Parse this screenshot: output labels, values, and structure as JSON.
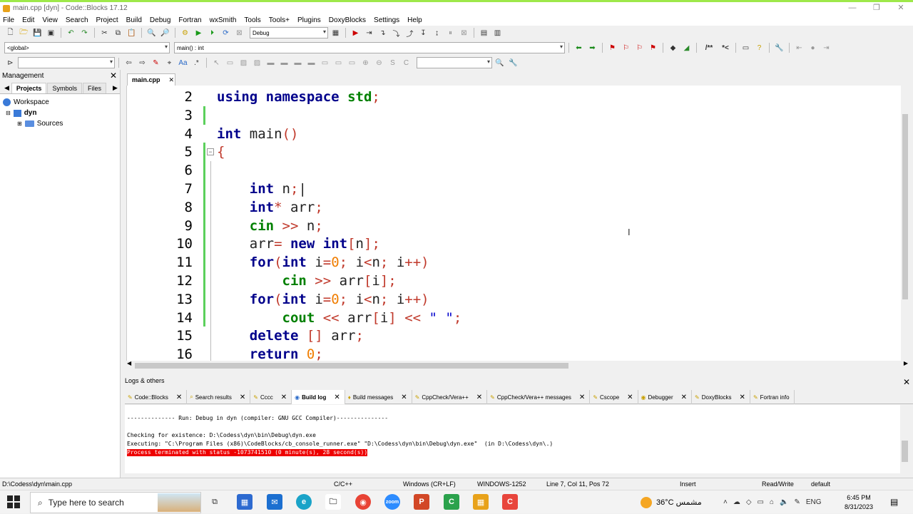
{
  "window": {
    "title": "main.cpp [dyn] - Code::Blocks 17.12",
    "controls": [
      "—",
      "❐",
      "✕"
    ]
  },
  "menu": [
    "File",
    "Edit",
    "View",
    "Search",
    "Project",
    "Build",
    "Debug",
    "Fortran",
    "wxSmith",
    "Tools",
    "Tools+",
    "Plugins",
    "DoxyBlocks",
    "Settings",
    "Help"
  ],
  "toolbar": {
    "build_target": "Debug",
    "scope": "<global>",
    "function": "main() : int"
  },
  "management": {
    "title": "Management",
    "tabs": [
      "Projects",
      "Symbols",
      "Files"
    ],
    "tree": [
      {
        "label": "Workspace",
        "icon": "workspace-icon"
      },
      {
        "label": "dyn",
        "icon": "project-icon"
      },
      {
        "label": "Sources",
        "icon": "folder-icon"
      }
    ]
  },
  "editor": {
    "tab_label": "main.cpp",
    "lines": [
      {
        "no": "2",
        "tokens": [
          [
            "kw",
            "using"
          ],
          [
            "id",
            " "
          ],
          [
            "kw",
            "namespace"
          ],
          [
            "id",
            " "
          ],
          [
            "ns",
            "std"
          ],
          [
            "op",
            ";"
          ]
        ]
      },
      {
        "no": "3",
        "tokens": []
      },
      {
        "no": "4",
        "tokens": [
          [
            "kw",
            "int"
          ],
          [
            "id",
            " main"
          ],
          [
            "op",
            "()"
          ]
        ]
      },
      {
        "no": "5",
        "tokens": [
          [
            "op",
            "{"
          ]
        ]
      },
      {
        "no": "6",
        "tokens": []
      },
      {
        "no": "7",
        "tokens": [
          [
            "id",
            "    "
          ],
          [
            "kw",
            "int"
          ],
          [
            "id",
            " n"
          ],
          [
            "op",
            ";"
          ],
          [
            "id",
            "|"
          ]
        ]
      },
      {
        "no": "8",
        "tokens": [
          [
            "id",
            "    "
          ],
          [
            "kw",
            "int"
          ],
          [
            "op",
            "*"
          ],
          [
            "id",
            " arr"
          ],
          [
            "op",
            ";"
          ]
        ]
      },
      {
        "no": "9",
        "tokens": [
          [
            "id",
            "    "
          ],
          [
            "ns",
            "cin"
          ],
          [
            "id",
            " "
          ],
          [
            "op",
            ">>"
          ],
          [
            "id",
            " n"
          ],
          [
            "op",
            ";"
          ]
        ]
      },
      {
        "no": "10",
        "tokens": [
          [
            "id",
            "    arr"
          ],
          [
            "op",
            "="
          ],
          [
            "id",
            " "
          ],
          [
            "kw",
            "new"
          ],
          [
            "id",
            " "
          ],
          [
            "kw",
            "int"
          ],
          [
            "op",
            "["
          ],
          [
            "id",
            "n"
          ],
          [
            "op",
            "];"
          ]
        ]
      },
      {
        "no": "11",
        "tokens": [
          [
            "id",
            "    "
          ],
          [
            "kw",
            "for"
          ],
          [
            "op",
            "("
          ],
          [
            "kw",
            "int"
          ],
          [
            "id",
            " i"
          ],
          [
            "op",
            "="
          ],
          [
            "num",
            "0"
          ],
          [
            "op",
            ";"
          ],
          [
            "id",
            " i"
          ],
          [
            "op",
            "<"
          ],
          [
            "id",
            "n"
          ],
          [
            "op",
            ";"
          ],
          [
            "id",
            " i"
          ],
          [
            "op",
            "++)"
          ]
        ]
      },
      {
        "no": "12",
        "tokens": [
          [
            "id",
            "        "
          ],
          [
            "ns",
            "cin"
          ],
          [
            "id",
            " "
          ],
          [
            "op",
            ">>"
          ],
          [
            "id",
            " arr"
          ],
          [
            "op",
            "["
          ],
          [
            "id",
            "i"
          ],
          [
            "op",
            "];"
          ]
        ]
      },
      {
        "no": "13",
        "tokens": [
          [
            "id",
            "    "
          ],
          [
            "kw",
            "for"
          ],
          [
            "op",
            "("
          ],
          [
            "kw",
            "int"
          ],
          [
            "id",
            " i"
          ],
          [
            "op",
            "="
          ],
          [
            "num",
            "0"
          ],
          [
            "op",
            ";"
          ],
          [
            "id",
            " i"
          ],
          [
            "op",
            "<"
          ],
          [
            "id",
            "n"
          ],
          [
            "op",
            ";"
          ],
          [
            "id",
            " i"
          ],
          [
            "op",
            "++)"
          ]
        ]
      },
      {
        "no": "14",
        "tokens": [
          [
            "id",
            "        "
          ],
          [
            "ns",
            "cout"
          ],
          [
            "id",
            " "
          ],
          [
            "op",
            "<<"
          ],
          [
            "id",
            " arr"
          ],
          [
            "op",
            "["
          ],
          [
            "id",
            "i"
          ],
          [
            "op",
            "]"
          ],
          [
            "id",
            " "
          ],
          [
            "op",
            "<<"
          ],
          [
            "id",
            " "
          ],
          [
            "str",
            "\" \""
          ],
          [
            "op",
            ";"
          ]
        ]
      },
      {
        "no": "15",
        "tokens": [
          [
            "id",
            "    "
          ],
          [
            "kw",
            "delete"
          ],
          [
            "id",
            " "
          ],
          [
            "op",
            "[]"
          ],
          [
            "id",
            " arr"
          ],
          [
            "op",
            ";"
          ]
        ]
      },
      {
        "no": "16",
        "tokens": [
          [
            "id",
            "    "
          ],
          [
            "kw",
            "return"
          ],
          [
            "id",
            " "
          ],
          [
            "num",
            "0"
          ],
          [
            "op",
            ";"
          ]
        ]
      }
    ]
  },
  "logs": {
    "title": "Logs & others",
    "tabs": [
      {
        "label": "Code::Blocks",
        "active": false
      },
      {
        "label": "Search results",
        "active": false
      },
      {
        "label": "Cccc",
        "active": false
      },
      {
        "label": "Build log",
        "active": true
      },
      {
        "label": "Build messages",
        "active": false
      },
      {
        "label": "CppCheck/Vera++",
        "active": false
      },
      {
        "label": "CppCheck/Vera++ messages",
        "active": false
      },
      {
        "label": "Cscope",
        "active": false
      },
      {
        "label": "Debugger",
        "active": false
      },
      {
        "label": "DoxyBlocks",
        "active": false
      },
      {
        "label": "Fortran info",
        "active": false
      }
    ],
    "lines": [
      "-------------- Run: Debug in dyn (compiler: GNU GCC Compiler)---------------",
      "",
      "Checking for existence: D:\\Codess\\dyn\\bin\\Debug\\dyn.exe",
      "Executing: \"C:\\Program Files (x86)\\CodeBlocks/cb_console_runner.exe\" \"D:\\Codess\\dyn\\bin\\Debug\\dyn.exe\"  (in D:\\Codess\\dyn\\.)"
    ],
    "error_line": "Process terminated with status -1073741510 (0 minute(s), 28 second(s))"
  },
  "status": {
    "path": "D:\\Codess\\dyn\\main.cpp",
    "lang": "C/C++",
    "eol": "Windows (CR+LF)",
    "encoding": "WINDOWS-1252",
    "position": "Line 7, Col 11, Pos 72",
    "mode": "Insert",
    "rw": "Read/Write",
    "profile": "default"
  },
  "taskbar": {
    "search_placeholder": "Type here to search",
    "weather": "36°C  مشمس",
    "lang": "ENG",
    "time": "6:45 PM",
    "date": "8/31/2023",
    "colors": {
      "accent": "#9ee84a",
      "error": "#e00000",
      "keyword": "#00008b",
      "namespace": "#008000"
    }
  }
}
